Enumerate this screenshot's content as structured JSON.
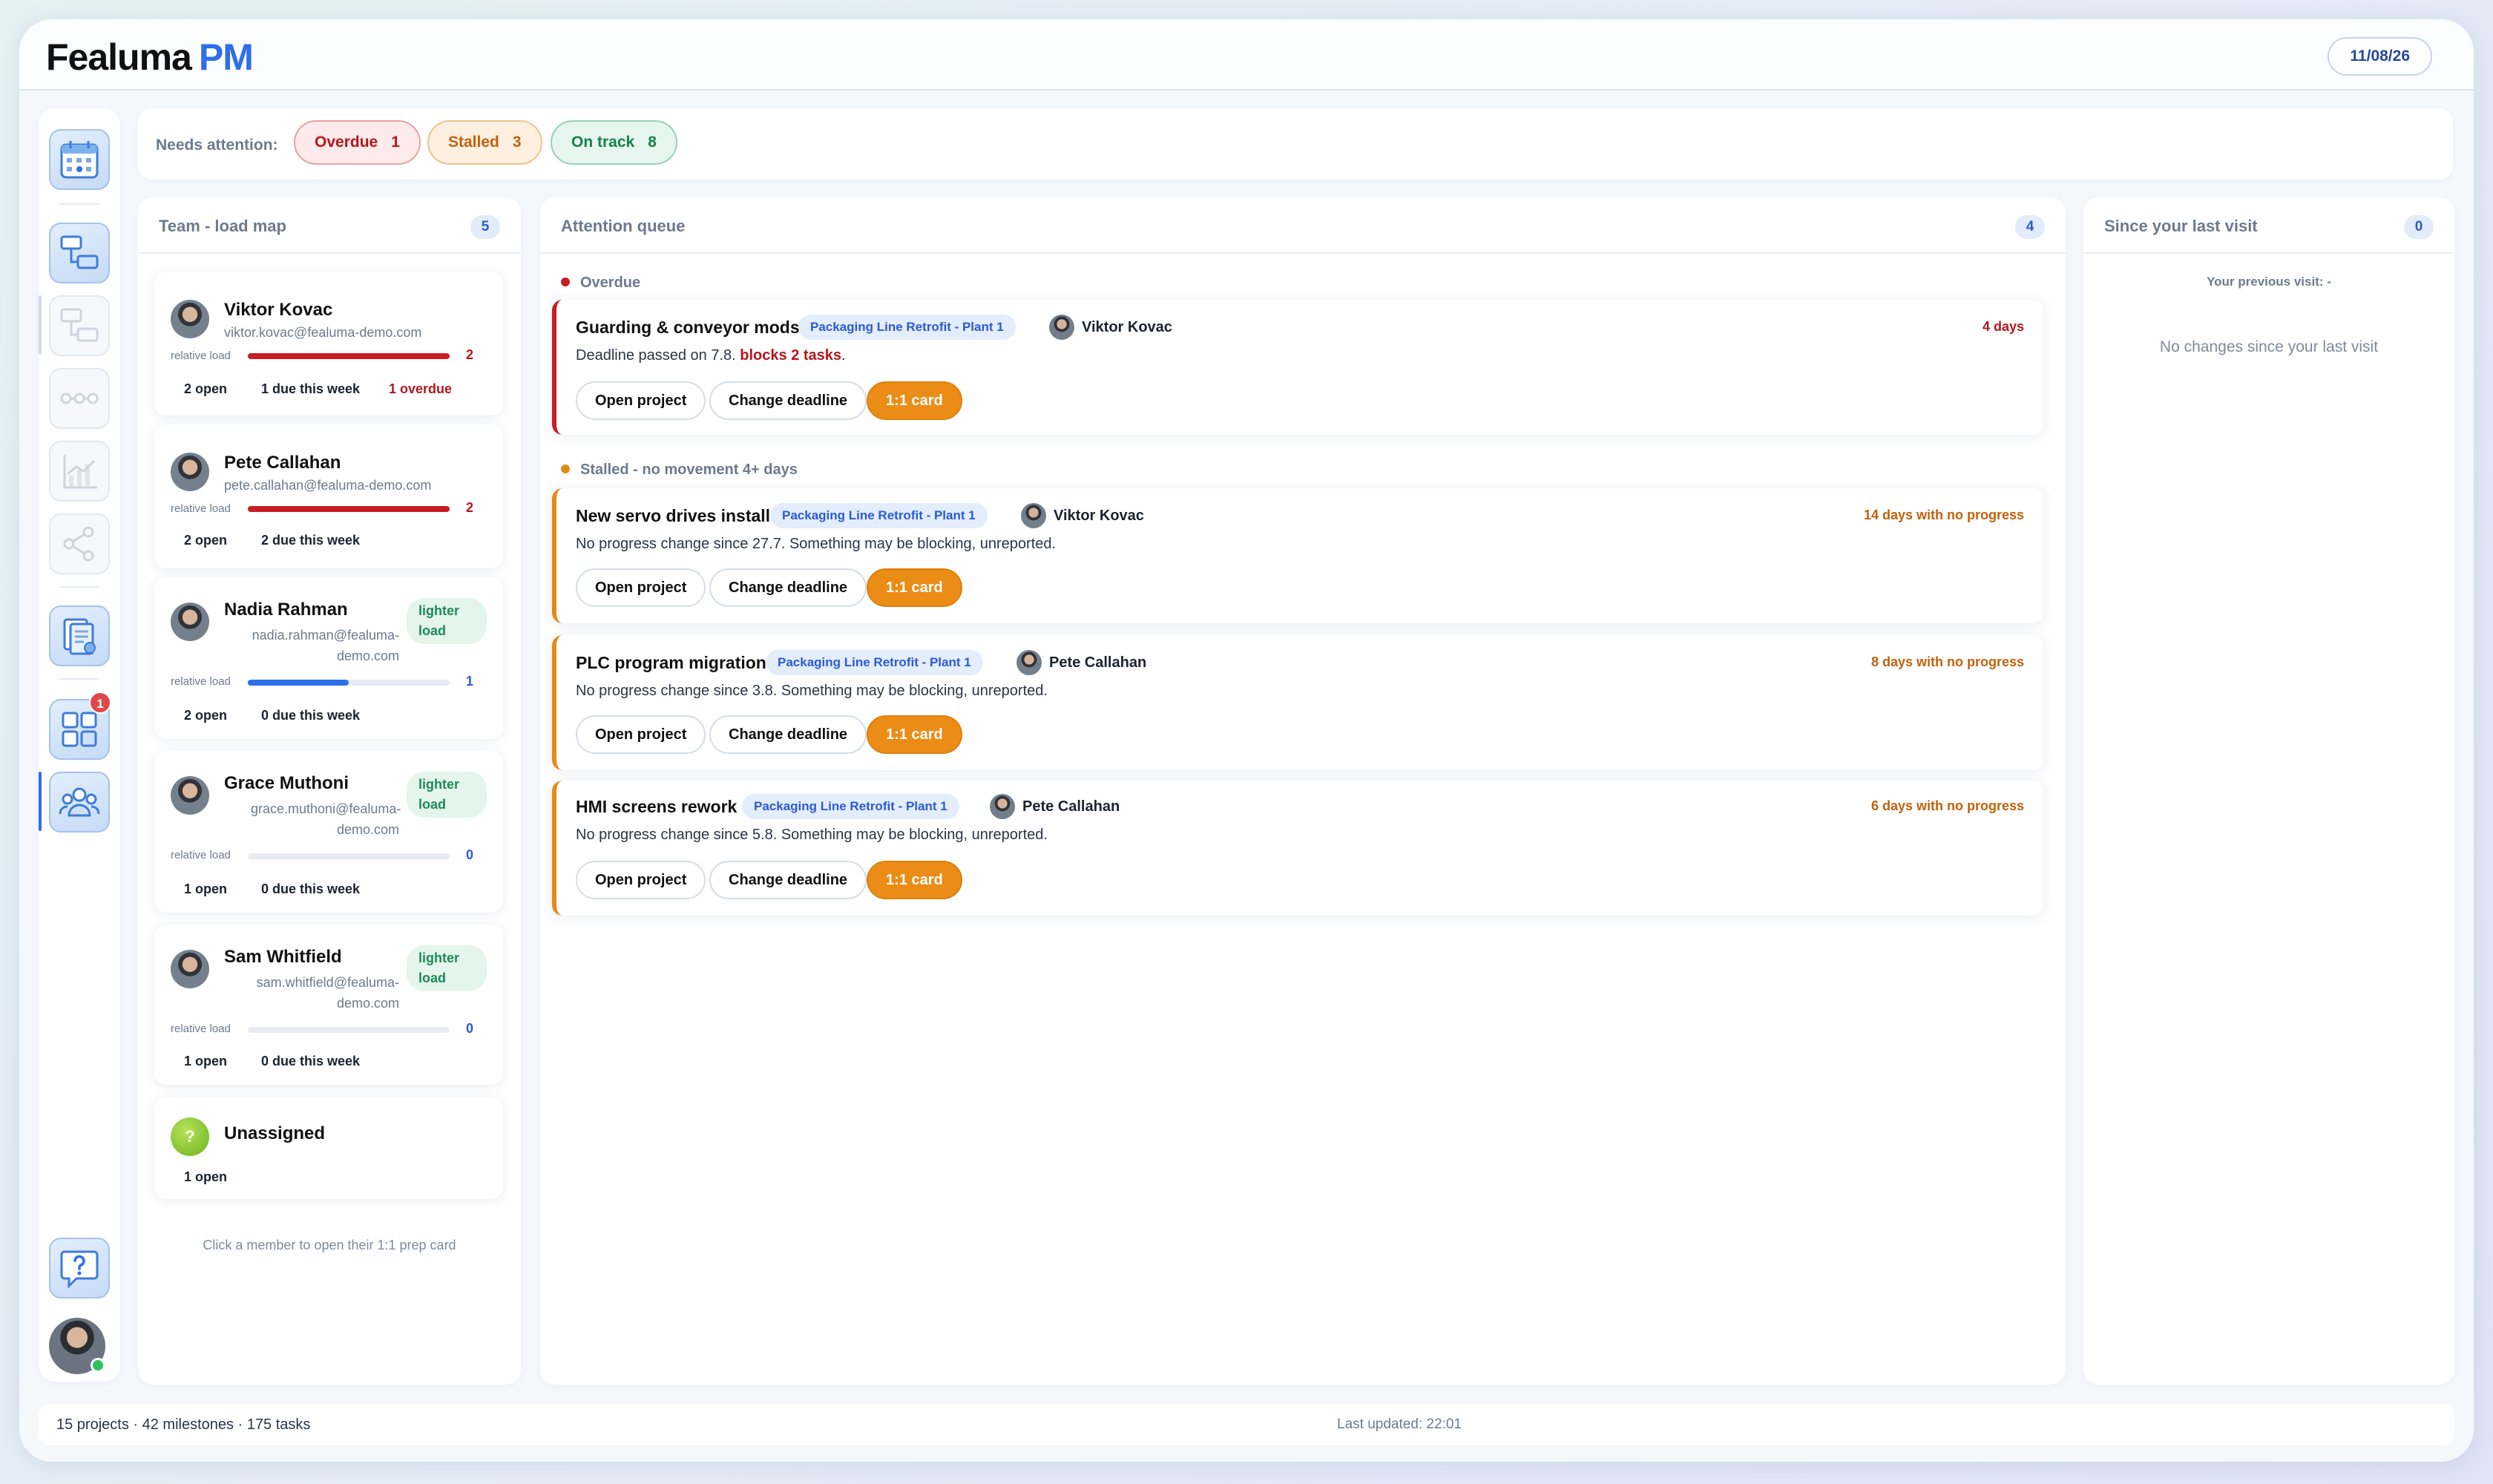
{
  "app": {
    "logo_text": "Fealuma",
    "logo_suffix": "PM",
    "date": "11/08/26"
  },
  "attention": {
    "label": "Needs attention:",
    "chips": [
      {
        "label": "Overdue",
        "count": "1"
      },
      {
        "label": "Stalled",
        "count": "3"
      },
      {
        "label": "On track",
        "count": "8"
      }
    ]
  },
  "sidebar": {
    "notification_count": "1",
    "icons": [
      "calendar-icon",
      "hierarchy-icon",
      "hierarchy-icon",
      "timeline-icon",
      "chart-icon",
      "share-icon",
      "documents-icon",
      "dashboard-icon",
      "team-icon",
      "help-icon"
    ]
  },
  "team": {
    "title": "Team - load map",
    "count": "5",
    "relative_load_label": "relative load",
    "lighter_label": "lighter load",
    "hint": "Click a member to open their 1:1 prep card",
    "members": [
      {
        "name": "Viktor Kovac",
        "email": "viktor.kovac@fealuma-demo.com",
        "load": "2",
        "load_fraction": 1.0,
        "open": "2 open",
        "due": "1 due this week",
        "overdue": "1 overdue"
      },
      {
        "name": "Pete Callahan",
        "email": "pete.callahan@fealuma-demo.com",
        "load": "2",
        "load_fraction": 1.0,
        "open": "2 open",
        "due": "2 due this week"
      },
      {
        "name": "Nadia Rahman",
        "email_line1": "nadia.rahman@fealuma-",
        "email_line2": "demo.com",
        "load": "1",
        "load_fraction": 0.5,
        "open": "2 open",
        "due": "0 due this week"
      },
      {
        "name": "Grace Muthoni",
        "email_line1": "grace.muthoni@fealuma-",
        "email_line2": "demo.com",
        "load": "0",
        "load_fraction": 0,
        "open": "1 open",
        "due": "0 due this week"
      },
      {
        "name": "Sam Whitfield",
        "email_line1": "sam.whitfield@fealuma-",
        "email_line2": "demo.com",
        "load": "0",
        "load_fraction": 0,
        "open": "1 open",
        "due": "0 due this week"
      }
    ],
    "unassigned": {
      "avatar": "?",
      "name": "Unassigned",
      "open": "1 open"
    }
  },
  "queue": {
    "title": "Attention queue",
    "count": "4",
    "overdue_section": "Overdue",
    "stalled_section": "Stalled - no movement 4+ days",
    "buttons": {
      "open": "Open project",
      "deadline": "Change deadline",
      "card": "1:1 card"
    },
    "items": [
      {
        "title": "Guarding & conveyor mods",
        "project": "Packaging Line Retrofit - Plant 1",
        "person": "Viktor Kovac",
        "age": "4 days",
        "desc": "Deadline passed on 7.8.",
        "blocks": "blocks 2 tasks",
        "desc_end": "."
      },
      {
        "title": "New servo drives install",
        "project": "Packaging Line Retrofit - Plant 1",
        "person": "Viktor Kovac",
        "age": "14 days with no progress",
        "desc": "No progress change since 27.7. Something may be blocking, unreported."
      },
      {
        "title": "PLC program migration",
        "project": "Packaging Line Retrofit - Plant 1",
        "person": "Pete Callahan",
        "age": "8 days with no progress",
        "desc": "No progress change since 3.8. Something may be blocking, unreported."
      },
      {
        "title": "HMI screens rework",
        "project": "Packaging Line Retrofit - Plant 1",
        "person": "Pete Callahan",
        "age": "6 days with no progress",
        "desc": "No progress change since 5.8. Something may be blocking, unreported."
      }
    ]
  },
  "since": {
    "title": "Since your last visit",
    "count": "0",
    "previous": "Your previous visit: -",
    "empty": "No changes since your last visit"
  },
  "footer": {
    "stats": "15 projects · 42 milestones · 175 tasks",
    "updated": "Last updated: 22:01"
  },
  "colors": {
    "accent": "#2d6fe8",
    "overdue": "#b3171d",
    "stalled": "#e58a16",
    "ontrack": "#17804c"
  }
}
